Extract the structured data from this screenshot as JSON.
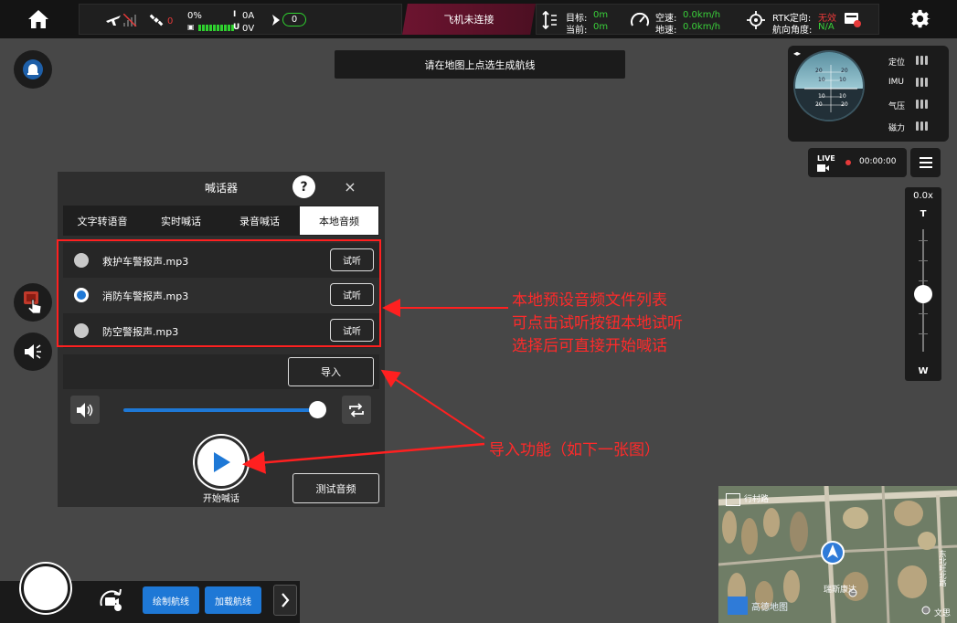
{
  "topbar": {
    "battery_percent": "0%",
    "current": "0A",
    "voltage": "0V",
    "gps_count": "0",
    "nav_count": "0",
    "connection_status": "飞机未连接",
    "target_label": "目标:",
    "target_value": "0m",
    "current_label": "当前:",
    "current_value": "0m",
    "airspeed_label": "空速:",
    "airspeed_value": "0.0km/h",
    "groundspeed_label": "地速:",
    "groundspeed_value": "0.0km/h",
    "rtk_label": "RTK定向:",
    "rtk_value": "无效",
    "heading_label": "航向角度:",
    "heading_value": "N/A"
  },
  "hint": "请在地图上点选生成航线",
  "attitude": {
    "sensors": [
      "定位",
      "IMU",
      "气压",
      "磁力"
    ],
    "ticks": [
      "20",
      "10",
      "10",
      "20",
      "20",
      "10",
      "10",
      "20"
    ]
  },
  "live": {
    "label": "LIVE",
    "time": "00:00:00"
  },
  "zoom": {
    "value": "0.0x",
    "tele": "T",
    "wide": "W"
  },
  "dialog": {
    "title": "喊话器",
    "help": "?",
    "close": "×",
    "tabs": [
      "文字转语音",
      "实时喊话",
      "录音喊话",
      "本地音频"
    ],
    "active_tab": "本地音频",
    "files": [
      {
        "name": "救护车警报声.mp3",
        "selected": false
      },
      {
        "name": "消防车警报声.mp3",
        "selected": true
      },
      {
        "name": "防空警报声.mp3",
        "selected": false
      }
    ],
    "listen_label": "试听",
    "import_label": "导入",
    "volume_level": 0.95,
    "play_label": "开始喊话",
    "test_label": "测试音频"
  },
  "annotations": {
    "list_note": [
      "本地预设音频文件列表",
      "可点击试听按钮本地试听",
      "选择后可直接开始喊话"
    ],
    "import_note": "导入功能（如下一张图）"
  },
  "map": {
    "road": "行村路",
    "poi": "瑞斯康达",
    "poi2": "文思",
    "side_road": "东北旺北路",
    "logo": "高德地图"
  },
  "bottombar": {
    "draw_route": "绘制航线",
    "load_route": "加载航线"
  },
  "colors": {
    "accent_blue": "#1e78d6",
    "annotation_red": "#ff2a2a",
    "connection_bg": "#6d1430",
    "status_green": "#3ad13a"
  }
}
